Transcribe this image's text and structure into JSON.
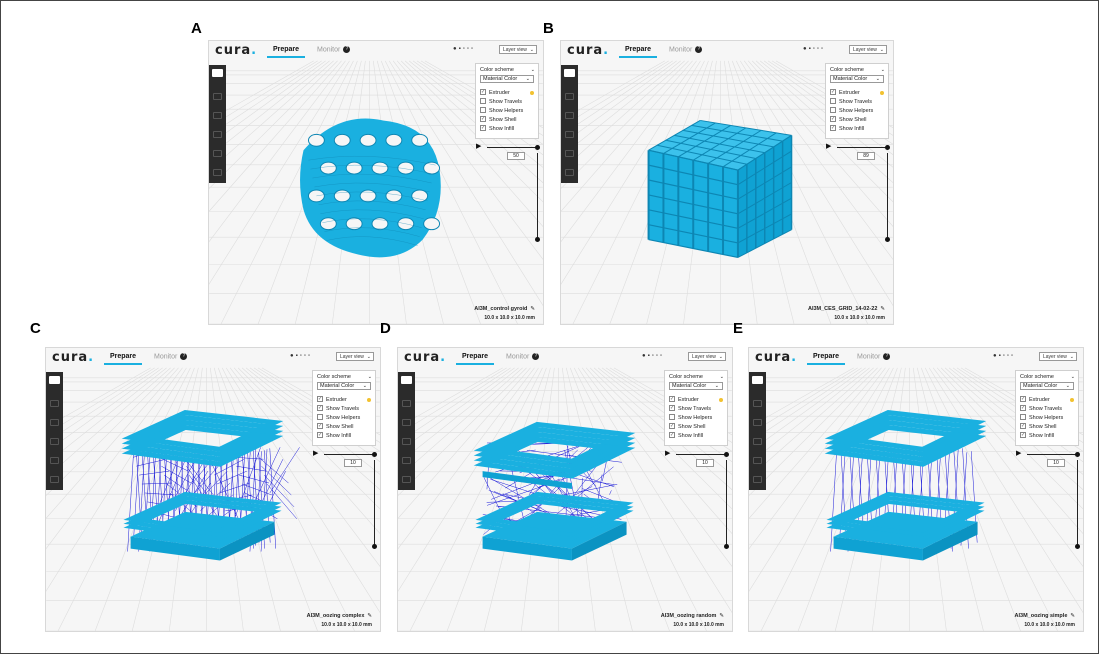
{
  "app": {
    "logo": "cura",
    "tab_prepare": "Prepare",
    "tab_monitor": "Monitor",
    "view_mode": "Layer view",
    "icon_names": [
      "folder-icon",
      "cube-view-icon",
      "front-view-icon",
      "top-view-icon",
      "left-view-icon",
      "right-view-icon"
    ]
  },
  "panel": {
    "title": "Color scheme",
    "scheme_value": "Material Color",
    "items": [
      "Extruder",
      "Show Travels",
      "Show Helpers",
      "Show Shell",
      "Show Infill"
    ]
  },
  "panels": [
    {
      "label": "A",
      "layer": "50",
      "filename": "AI3M_control gyroid",
      "size": "10.0 x 10.0 x 10.0 mm",
      "checks": [
        true,
        false,
        false,
        true,
        true
      ]
    },
    {
      "label": "B",
      "layer": "89",
      "filename": "AI3M_CES_GRID_14-02-22",
      "size": "10.0 x 10.0 x 10.0 mm",
      "checks": [
        true,
        false,
        false,
        true,
        true
      ]
    },
    {
      "label": "C",
      "layer": "10",
      "filename": "AI3M_oozing complex",
      "size": "10.0 x 10.0 x 10.0 mm",
      "checks": [
        true,
        true,
        false,
        true,
        true
      ]
    },
    {
      "label": "D",
      "layer": "10",
      "filename": "AI3M_oozing random",
      "size": "10.0 x 10.0 x 10.0 mm",
      "checks": [
        true,
        true,
        false,
        true,
        true
      ]
    },
    {
      "label": "E",
      "layer": "10",
      "filename": "AI3M_oozing simple",
      "size": "10.0 x 10.0 x 10.0 mm",
      "checks": [
        true,
        true,
        false,
        true,
        true
      ]
    }
  ],
  "colors": {
    "model": "#1ab0e0",
    "model_dark": "#0d86b3",
    "travel": "#1a1ad8",
    "accent": "#f2c230"
  }
}
